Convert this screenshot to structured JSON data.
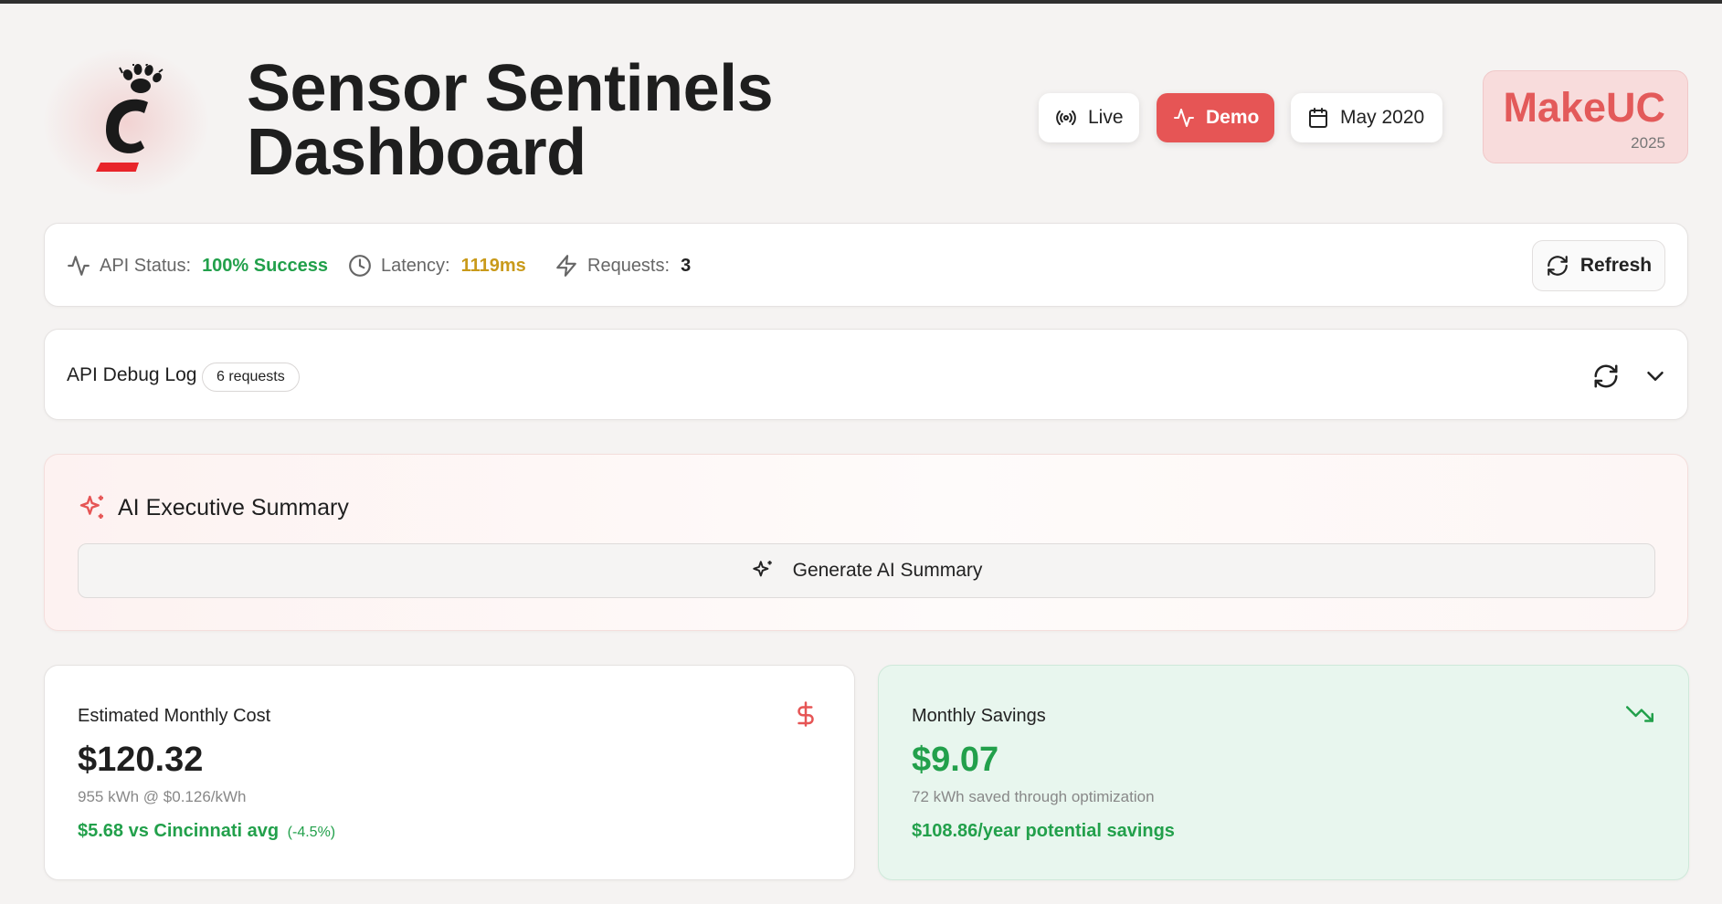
{
  "header": {
    "title_line1": "Sensor Sentinels",
    "title_line2": "Dashboard",
    "buttons": {
      "live": "Live",
      "demo": "Demo",
      "date": "May 2020"
    },
    "brand": {
      "name": "MakeUC",
      "year": "2025"
    }
  },
  "status": {
    "api_label": "API Status:",
    "api_value": "100% Success",
    "latency_label": "Latency:",
    "latency_value": "1119ms",
    "requests_label": "Requests:",
    "requests_value": "3",
    "refresh_label": "Refresh"
  },
  "debug": {
    "title": "API Debug Log",
    "badge": "6 requests"
  },
  "ai_summary": {
    "title": "AI Executive Summary",
    "button": "Generate AI Summary"
  },
  "metrics": {
    "cost": {
      "label": "Estimated Monthly Cost",
      "value": "$120.32",
      "sub": "955 kWh @ $0.126/kWh",
      "compare": "$5.68 vs Cincinnati avg",
      "compare_pct": "(-4.5%)"
    },
    "savings": {
      "label": "Monthly Savings",
      "value": "$9.07",
      "sub": "72 kWh saved through optimization",
      "yearly": "$108.86/year potential savings"
    }
  },
  "colors": {
    "accent_red": "#e65555",
    "success_green": "#22a04b",
    "latency_amber": "#c99a1a",
    "text_dark": "#1f1f1f"
  },
  "icons": {
    "logo": "bearcat-c-logo",
    "live": "broadcast-icon",
    "demo": "activity-icon",
    "date": "calendar-icon",
    "api": "activity-icon",
    "latency": "clock-icon",
    "requests": "lightning-icon",
    "refresh": "refresh-icon",
    "debug_refresh": "refresh-icon",
    "debug_toggle": "chevron-down-icon",
    "ai": "sparkles-icon",
    "cost": "dollar-icon",
    "savings": "trending-down-icon"
  }
}
